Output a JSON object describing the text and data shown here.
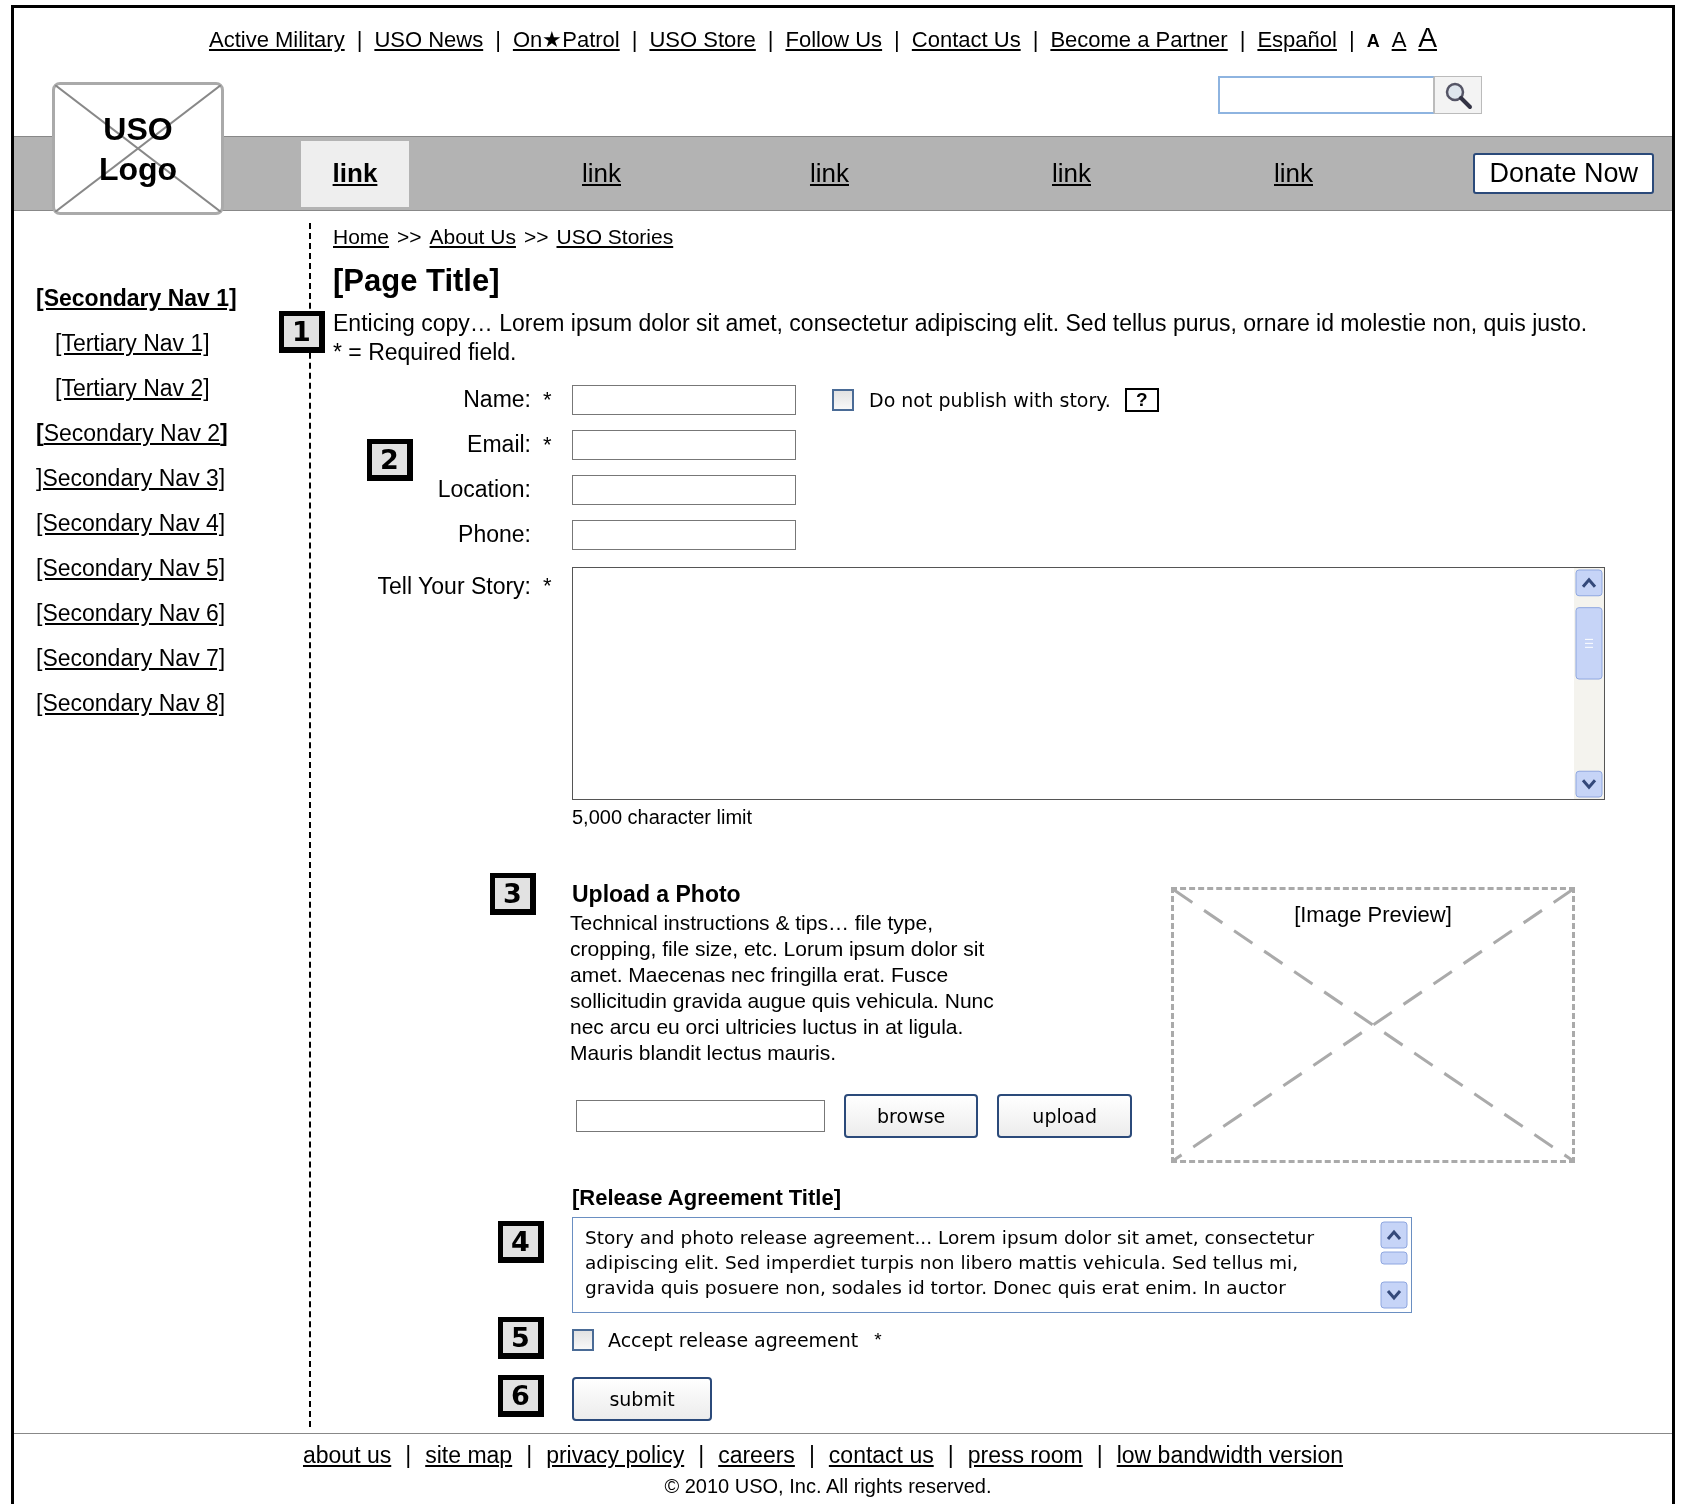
{
  "utility_links": [
    "Active Military",
    "USO News",
    "On★Patrol",
    "USO Store",
    "Follow Us",
    "Contact Us",
    "Become a Partner",
    "Español"
  ],
  "separator": "|",
  "font_sizes": [
    "A",
    "A",
    "A"
  ],
  "logo": [
    "USO",
    "Logo"
  ],
  "main_nav": [
    {
      "label": "link",
      "selected": true
    },
    {
      "label": "link",
      "selected": false
    },
    {
      "label": "link",
      "selected": false
    },
    {
      "label": "link",
      "selected": false
    },
    {
      "label": "link",
      "selected": false
    }
  ],
  "donate_button": "Donate Now",
  "secondary_nav": [
    {
      "label": "[Secondary Nav 1]",
      "selected": true,
      "children": [
        {
          "label": "[Tertiary Nav 1]",
          "selected": false
        },
        {
          "label": "[Tertiary Nav 2]",
          "selected": false
        }
      ]
    },
    {
      "label": "**[**Secondary Nav 2**]**",
      "selected": false
    },
    {
      "label": "]Secondary Nav 3]",
      "selected": false
    },
    {
      "label": "[Secondary Nav 4]",
      "selected": false
    },
    {
      "label": "[Secondary Nav 5]",
      "selected": false
    },
    {
      "label": "[Secondary Nav 6]",
      "selected": false
    },
    {
      "label": "[Secondary Nav 7]",
      "selected": false
    },
    {
      "label": "[Secondary Nav 8]",
      "selected": false
    }
  ],
  "breadcrumb": {
    "items": [
      "Home",
      "About Us",
      "USO Stories"
    ],
    "separator": ">>"
  },
  "page_title": "[Page Title]",
  "intro": "Enticing copy… Lorem ipsum dolor sit amet, consectetur adipiscing elit. Sed tellus purus, ornare id molestie non, quis justo.",
  "required_note": "* = Required field.",
  "form": {
    "fields": [
      {
        "label": "Name:",
        "mark": "*"
      },
      {
        "label": "Email:",
        "mark": "*"
      },
      {
        "label": "Location:"
      },
      {
        "label": "Phone:"
      }
    ],
    "do_not_publish": {
      "label": "Do not publish with story.",
      "checked": false
    },
    "help": "?",
    "story": {
      "label": "Tell Your Story:",
      "mark": "*",
      "note": "5,000 character limit"
    }
  },
  "upload": {
    "title": "Upload a Photo",
    "text": "Technical instructions & tips… file type, cropping, file size, etc.  Lorum ipsum dolor sit amet. Maecenas nec fringilla erat. Fusce sollicitudin gravida augue quis vehicula. Nunc nec arcu eu orci ultricies luctus in at ligula. Mauris blandit lectus mauris.",
    "buttons": [
      "browse",
      "upload"
    ],
    "preview": "[Image Preview]"
  },
  "release": {
    "title": "[Release Agreement Title]",
    "text": "Story and photo release agreement... Lorem ipsum dolor sit amet, consectetur adipiscing elit. Sed imperdiet turpis non libero mattis vehicula. Sed tellus mi, gravida quis posuere non, sodales id tortor. Donec quis erat enim. In auctor",
    "accept": {
      "label": "Accept release agreement",
      "mark": "*",
      "checked": false
    },
    "submit": "submit"
  },
  "badges": [
    "1",
    "2",
    "3",
    "4",
    "5",
    "6"
  ],
  "footer": {
    "links": [
      "about us",
      "site map",
      "privacy policy",
      "careers",
      "contact us",
      "press room",
      "low bandwidth version"
    ],
    "copyright": "© 2010 USO, Inc.  All rights reserved."
  }
}
